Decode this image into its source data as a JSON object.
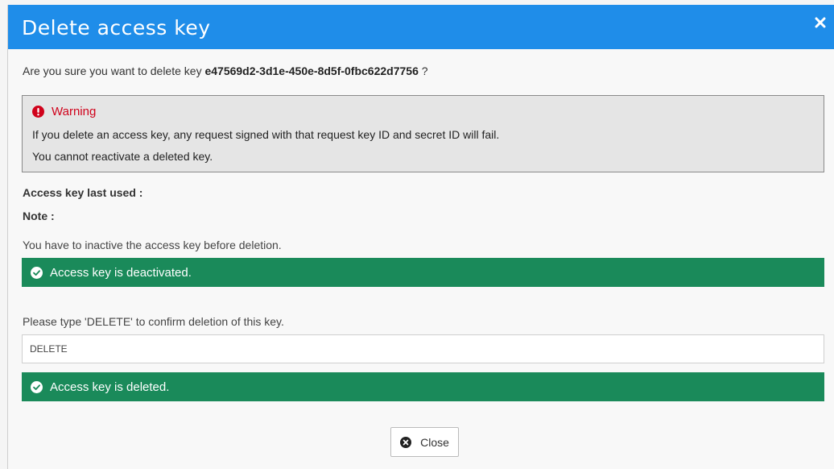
{
  "dialog": {
    "title": "Delete access key",
    "close_glyph": "×"
  },
  "question": {
    "prefix": "Are you sure you want to delete key ",
    "key_id": "e47569d2-3d1e-450e-8d5f-0fbc622d7756",
    "suffix": " ?"
  },
  "warning": {
    "heading": "Warning",
    "line1": "If you delete an access key, any request signed with that request key ID and secret ID will fail.",
    "line2": "You cannot reactivate a deleted key.",
    "icon": "exclamation-circle-icon"
  },
  "details": {
    "last_used_label": "Access key last used :",
    "note_label": "Note :"
  },
  "deactivate": {
    "instruction": "You have to inactive the access key before deletion.",
    "status": "Access key is deactivated.",
    "icon": "check-circle-icon"
  },
  "confirm": {
    "prompt": "Please type 'DELETE' to confirm deletion of this key.",
    "value": "DELETE",
    "status": "Access key is deleted.",
    "icon": "check-circle-icon"
  },
  "footer": {
    "close_label": "Close",
    "close_icon": "x-circle-icon"
  },
  "colors": {
    "header": "#1f8de9",
    "warning_text": "#d0021b",
    "success": "#1a8a5a"
  }
}
